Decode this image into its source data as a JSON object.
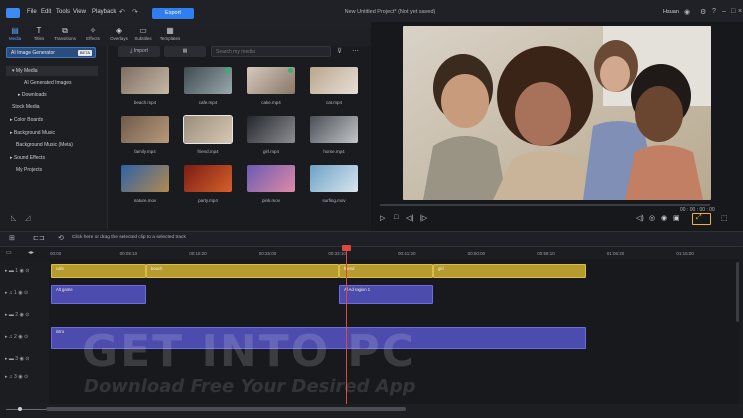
{
  "menu": {
    "items": [
      "File",
      "Edit",
      "Tools",
      "View",
      "Playback"
    ],
    "export_label": "Export",
    "project_title": "New Untitled Project* (Not yet saved)",
    "user": "Hsuan"
  },
  "toolbar": {
    "tools": [
      {
        "label": "Media",
        "icon": "folder-icon"
      },
      {
        "label": "Titles",
        "icon": "title-icon"
      },
      {
        "label": "Transitions",
        "icon": "transition-icon"
      },
      {
        "label": "Effects",
        "icon": "effects-icon"
      },
      {
        "label": "Overlays",
        "icon": "overlay-icon"
      },
      {
        "label": "Subtitles",
        "icon": "subtitle-icon"
      },
      {
        "label": "Templates",
        "icon": "template-icon"
      }
    ]
  },
  "left_panel": {
    "ai_gen_label": "AI Image Generator",
    "ai_gen_badge": "BETA",
    "items": [
      "My Media",
      "AI Generated Images",
      "Downloads",
      "Stock Media",
      "Color Boards",
      "Background Music",
      "Background Music (Meta)",
      "Sound Effects",
      "My Projects"
    ]
  },
  "media": {
    "import_label": "Import",
    "search_placeholder": "Search my media",
    "items": [
      {
        "name": "beach.mp4",
        "colors": [
          "#7d6e62",
          "#c7b9a6"
        ],
        "checked": false
      },
      {
        "name": "cafe.mp4",
        "colors": [
          "#3e4b52",
          "#9aa9ad"
        ],
        "checked": true
      },
      {
        "name": "cake.mp4",
        "colors": [
          "#d5c9bd",
          "#8a7767"
        ],
        "checked": true
      },
      {
        "name": "cat.mp4",
        "colors": [
          "#b9a68c",
          "#e7e0d6"
        ],
        "checked": false
      },
      {
        "name": "family.mp4",
        "colors": [
          "#6e5b4c",
          "#b89a7a"
        ],
        "checked": false
      },
      {
        "name": "friend.mp4",
        "colors": [
          "#9a8d7b",
          "#d7c8b3"
        ],
        "checked": false
      },
      {
        "name": "girl.mp4",
        "colors": [
          "#23262b",
          "#8d8f93"
        ],
        "checked": false
      },
      {
        "name": "horse.mp4",
        "colors": [
          "#4a4f56",
          "#c4c6c8"
        ],
        "checked": false
      },
      {
        "name": "nature.mov",
        "colors": [
          "#2f62a7",
          "#b28a4c"
        ],
        "checked": false
      },
      {
        "name": "party.mp4",
        "colors": [
          "#7a1d14",
          "#d7602a"
        ],
        "checked": false
      },
      {
        "name": "pink.mov",
        "colors": [
          "#6a5bb4",
          "#e08aa5"
        ],
        "checked": false
      },
      {
        "name": "surfing.mov",
        "colors": [
          "#6da1c5",
          "#d9e6ef"
        ],
        "checked": false
      }
    ]
  },
  "preview": {
    "time_code": "00 : 00 : 00 : 00"
  },
  "timeline": {
    "hint": "Click here or drag the selected clip to a selected track",
    "ruler_ticks": [
      "00:00",
      "00:08:10",
      "00:16:20",
      "00:25:00",
      "00:33:10",
      "00:41:20",
      "00:50:00",
      "00:58:10",
      "01:06:20",
      "01:15:00"
    ],
    "tracks": [
      "1",
      "1",
      "2",
      "2",
      "3",
      "3"
    ],
    "clips_video": [
      {
        "label": "cafe"
      },
      {
        "label": "beach"
      },
      {
        "label": "friend"
      },
      {
        "label": "girl"
      }
    ],
    "clips_audio": [
      {
        "label": "Alt game"
      },
      {
        "label": "Al Ad ragion 1"
      },
      {
        "label": "intro"
      }
    ]
  },
  "watermark": {
    "title": "GET INTO PC",
    "tagline": "Download Free Your Desired App"
  }
}
